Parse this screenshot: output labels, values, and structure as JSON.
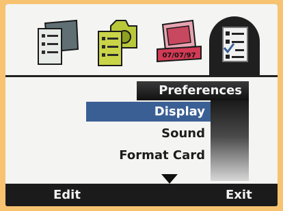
{
  "tabs": [
    {
      "name": "review",
      "icon": "photo-list-icon"
    },
    {
      "name": "capture",
      "icon": "camera-list-icon"
    },
    {
      "name": "print",
      "icon": "date-stamp-icon",
      "date_stamp": "07/07/97"
    },
    {
      "name": "setup",
      "icon": "checklist-icon",
      "active": true
    }
  ],
  "menu": {
    "header": "Preferences",
    "items": [
      {
        "label": "Display",
        "selected": true
      },
      {
        "label": "Sound",
        "selected": false
      },
      {
        "label": "Format Card",
        "selected": false
      }
    ],
    "more_indicator": "down-arrow-icon"
  },
  "softkeys": {
    "left": "Edit",
    "right": "Exit"
  },
  "colors": {
    "background": "#f7c371",
    "selection": "#3a5f94",
    "screen": "#f4f4f2"
  }
}
